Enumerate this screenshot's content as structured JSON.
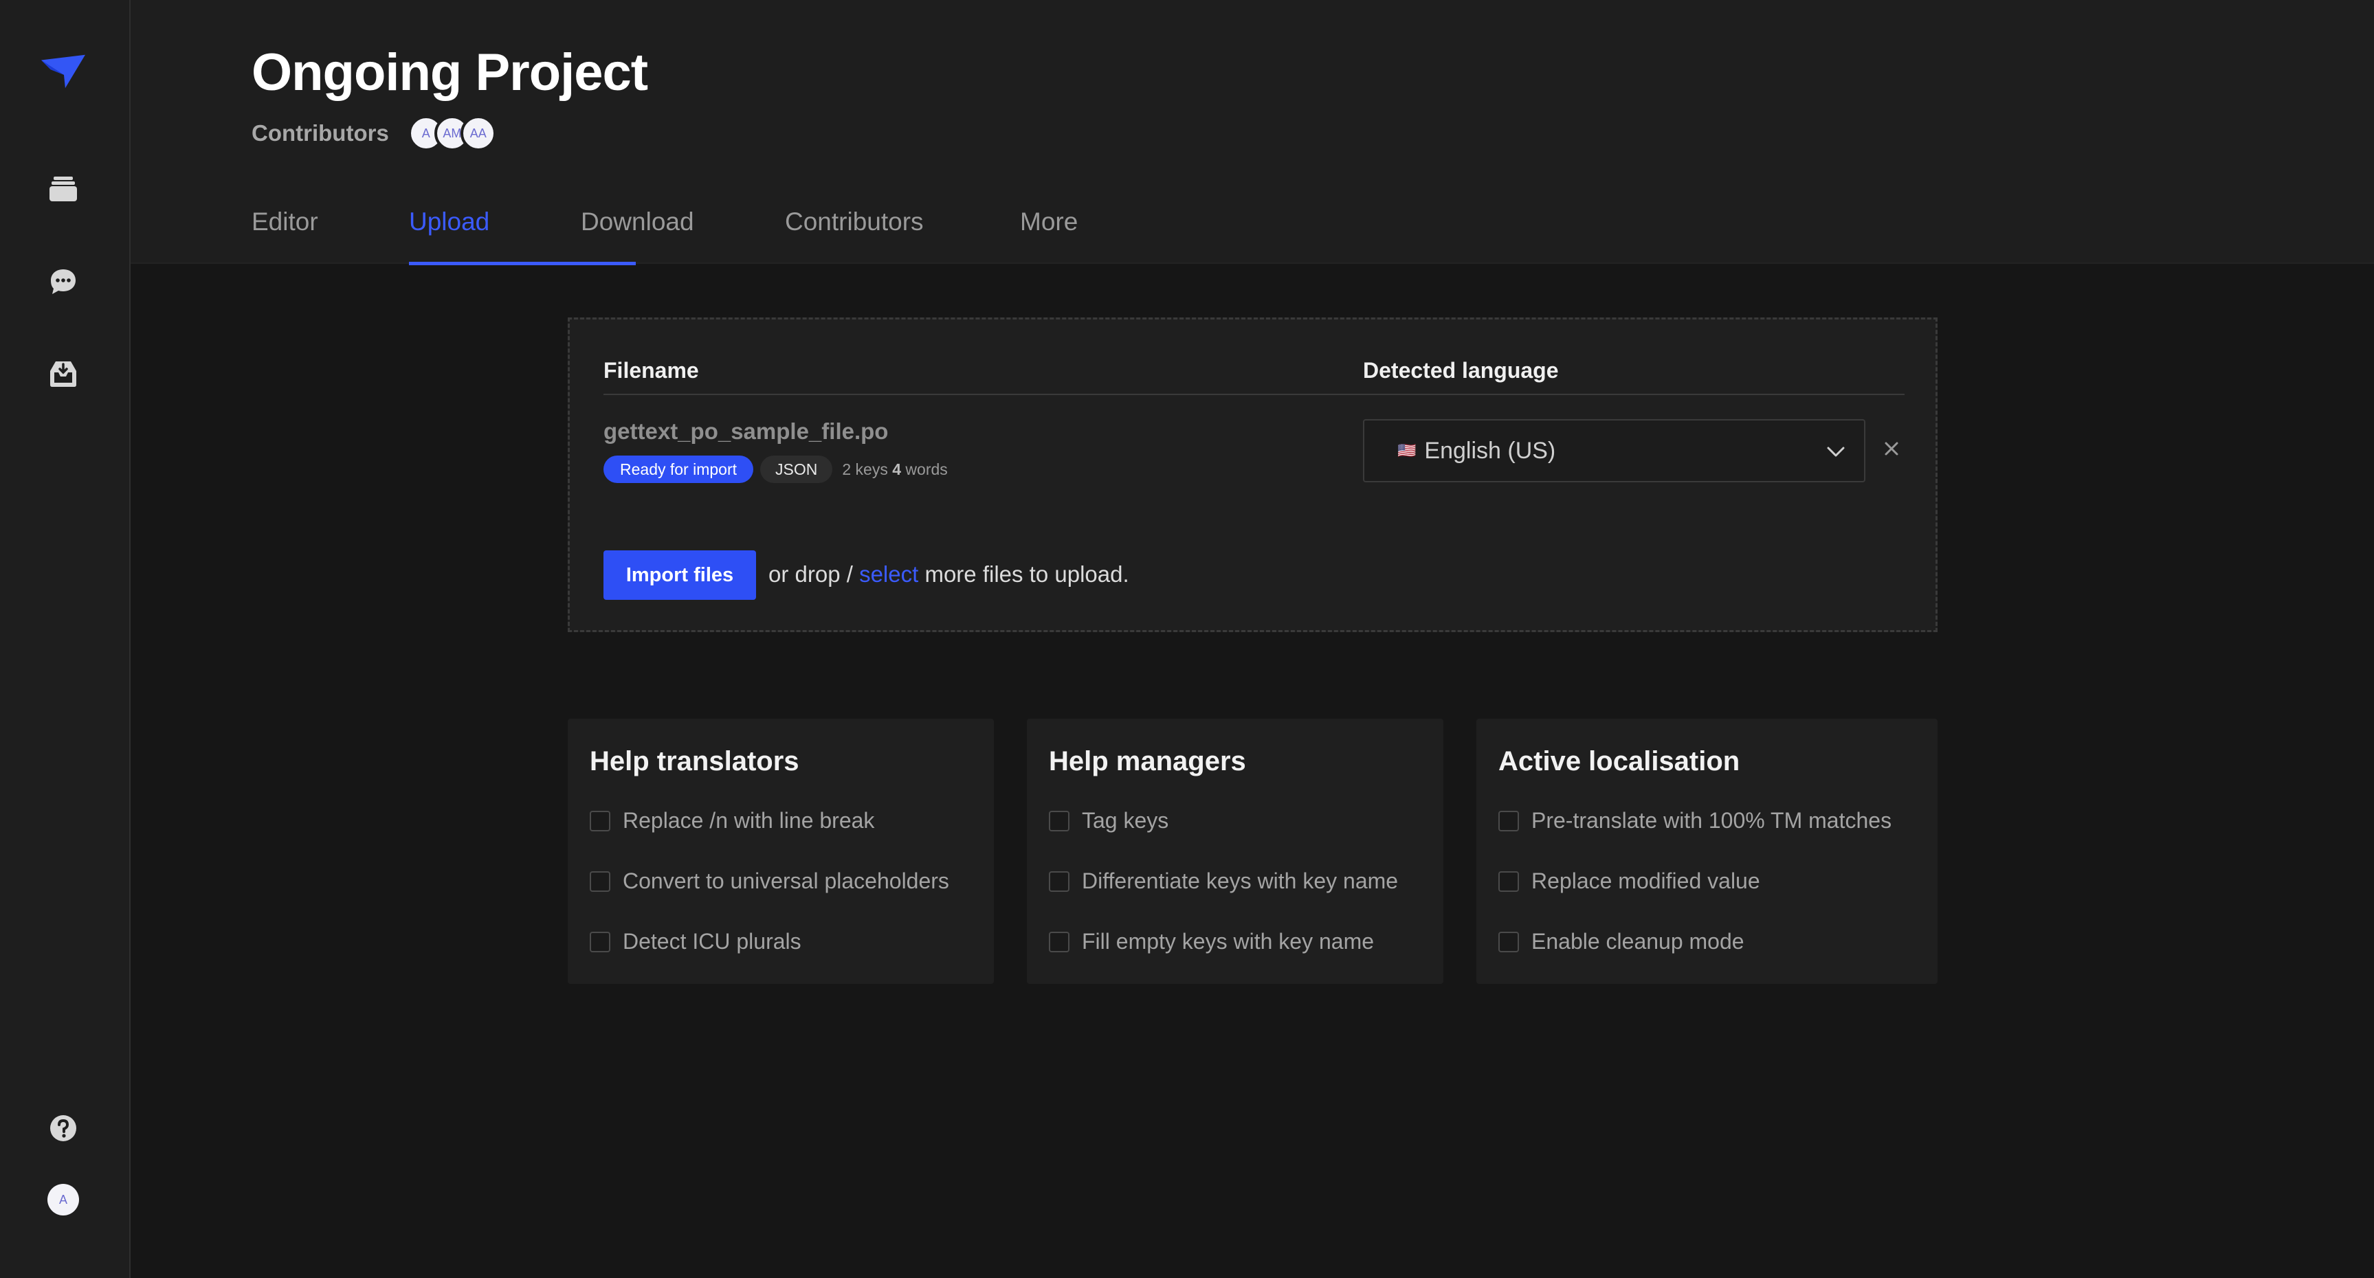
{
  "project": {
    "title": "Ongoing Project",
    "contributors_label": "Contributors",
    "avatars": [
      "A",
      "AM",
      "AA"
    ]
  },
  "tabs": [
    {
      "label": "Editor",
      "active": false
    },
    {
      "label": "Upload",
      "active": true
    },
    {
      "label": "Download",
      "active": false
    },
    {
      "label": "Contributors",
      "active": false
    },
    {
      "label": "More",
      "active": false
    }
  ],
  "sidebar": {
    "items": [
      "logo-icon",
      "projects-icon",
      "chat-icon",
      "inbox-icon",
      "help-icon"
    ],
    "user_avatar": "A"
  },
  "upload": {
    "filename_header": "Filename",
    "language_header": "Detected language",
    "file": {
      "name": "gettext_po_sample_file.po",
      "status": "Ready for import",
      "format": "JSON",
      "keys_count": "2",
      "keys_label": "keys",
      "words_count": "4",
      "words_label": "words",
      "flag": "🇺🇸",
      "language": "English (US)"
    },
    "import_button": "Import files",
    "drop_prefix": "or drop /",
    "drop_link": "select",
    "drop_suffix": "more files to upload."
  },
  "panels": [
    {
      "title": "Help translators",
      "options": [
        "Replace /n with line break",
        "Convert to universal placeholders",
        "Detect ICU plurals"
      ]
    },
    {
      "title": "Help managers",
      "options": [
        "Tag keys",
        "Differentiate keys with key name",
        "Fill empty keys with key name"
      ]
    },
    {
      "title": "Active localisation",
      "options": [
        "Pre-translate with 100% TM matches",
        "Replace modified value",
        "Enable cleanup mode"
      ]
    }
  ],
  "colors": {
    "accent": "#3b5bfd",
    "button": "#2e4ff5",
    "background": "#161616",
    "surface": "#1f1f1f"
  }
}
